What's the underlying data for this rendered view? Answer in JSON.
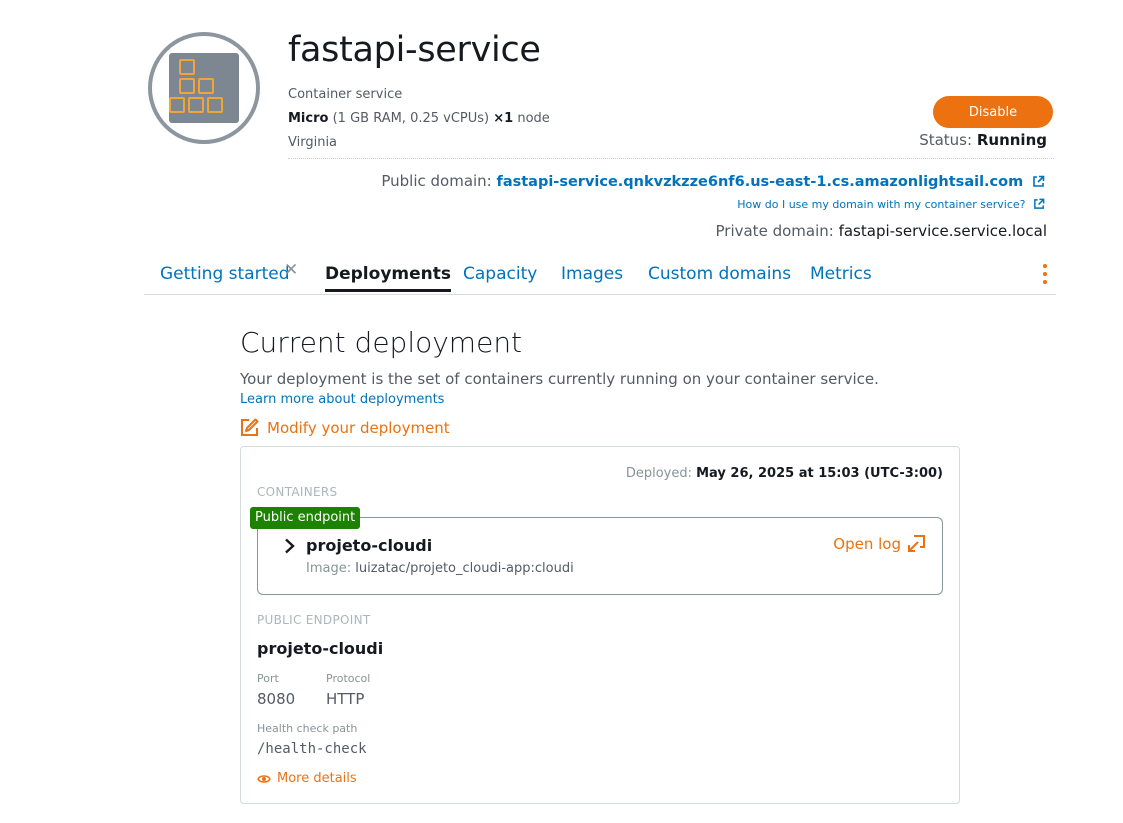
{
  "service": {
    "name": "fastapi-service",
    "type": "Container service",
    "plan_name": "Micro",
    "plan_specs": "(1 GB RAM, 0.25 vCPUs)",
    "plan_scale": "×1",
    "plan_unit": "node",
    "region": "Virginia",
    "disable_label": "Disable",
    "status_label": "Status:",
    "status_value": "Running",
    "public_domain_label": "Public domain:",
    "public_domain_value": "fastapi-service.qnkvzkzze6nf6.us-east-1.cs.amazonlightsail.com",
    "help_link": "How do I use my domain with my container service?",
    "private_domain_label": "Private domain:",
    "private_domain_value": "fastapi-service.service.local"
  },
  "tabs": [
    {
      "label": "Getting started"
    },
    {
      "label": "Deployments"
    },
    {
      "label": "Capacity"
    },
    {
      "label": "Images"
    },
    {
      "label": "Custom domains"
    },
    {
      "label": "Metrics"
    }
  ],
  "tab_close": "✕",
  "main": {
    "heading": "Current deployment",
    "description": "Your deployment is the set of containers currently running on your container service.",
    "learn_link": "Learn more about deployments",
    "modify_link": "Modify your deployment"
  },
  "deployment": {
    "deployed_label": "Deployed:",
    "deployed_value": "May 26, 2025 at 15:03 (UTC-3:00)",
    "containers_heading": "CONTAINERS",
    "badge": "Public endpoint",
    "container_name": "projeto-cloudi",
    "image_label": "Image:",
    "image_value": "luizatac/projeto_cloudi-app:cloudi",
    "open_log": "Open log",
    "endpoint_heading": "PUBLIC ENDPOINT",
    "endpoint_name": "projeto-cloudi",
    "port_label": "Port",
    "port_value": "8080",
    "protocol_label": "Protocol",
    "protocol_value": "HTTP",
    "health_label": "Health check path",
    "health_value": "/health-check",
    "more_details": "More details"
  },
  "colors": {
    "accent": "#ec7211",
    "link": "#0073bb",
    "badge": "#1d8102"
  }
}
